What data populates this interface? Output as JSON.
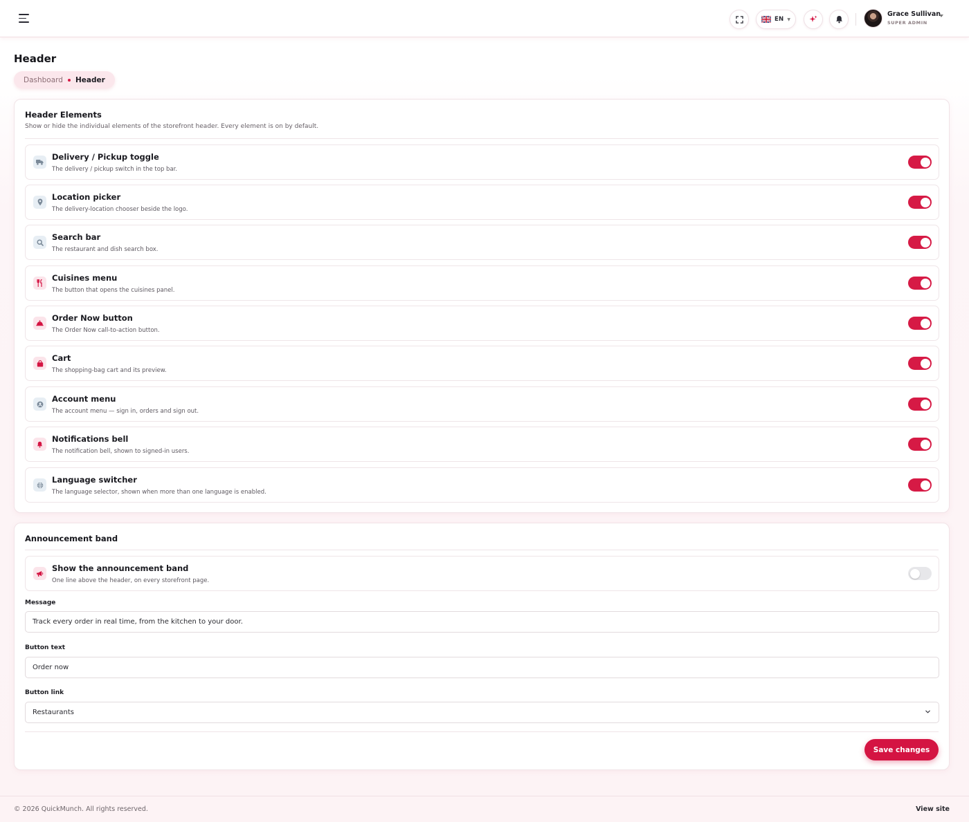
{
  "topbar": {
    "language_code": "EN",
    "user_name": "Grace Sullivan",
    "user_role": "SUPER ADMIN",
    "icons": [
      "menu-icon",
      "fullscreen-icon",
      "uk-flag-icon",
      "sparkle-icon",
      "bell-icon",
      "chevron-down-icon"
    ]
  },
  "page": {
    "title": "Header",
    "breadcrumb": {
      "parent": "Dashboard",
      "current": "Header"
    }
  },
  "header_elements": {
    "title": "Header Elements",
    "subtitle": "Show or hide the individual elements of the storefront header. Every element is on by default.",
    "items": [
      {
        "title": "Delivery / Pickup toggle",
        "desc": "The delivery / pickup switch in the top bar.",
        "enabled": true,
        "icon": "truck-icon"
      },
      {
        "title": "Location picker",
        "desc": "The delivery-location chooser beside the logo.",
        "enabled": true,
        "icon": "map-pin-icon"
      },
      {
        "title": "Search bar",
        "desc": "The restaurant and dish search box.",
        "enabled": true,
        "icon": "search-icon"
      },
      {
        "title": "Cuisines menu",
        "desc": "The button that opens the cuisines panel.",
        "enabled": true,
        "icon": "utensils-icon"
      },
      {
        "title": "Order Now button",
        "desc": "The Order Now call-to-action button.",
        "enabled": true,
        "icon": "cloche-icon"
      },
      {
        "title": "Cart",
        "desc": "The shopping-bag cart and its preview.",
        "enabled": true,
        "icon": "shopping-bag-icon"
      },
      {
        "title": "Account menu",
        "desc": "The account menu — sign in, orders and sign out.",
        "enabled": true,
        "icon": "user-circle-icon"
      },
      {
        "title": "Notifications bell",
        "desc": "The notification bell, shown to signed-in users.",
        "enabled": true,
        "icon": "bell-icon"
      },
      {
        "title": "Language switcher",
        "desc": "The language selector, shown when more than one language is enabled.",
        "enabled": true,
        "icon": "globe-icon"
      }
    ]
  },
  "announcement": {
    "title": "Announcement band",
    "toggle_title": "Show the announcement band",
    "toggle_desc": "One line above the header, on every storefront page.",
    "enabled": false,
    "icon": "megaphone-icon",
    "message_label": "Message",
    "message_value": "Track every order in real time, from the kitchen to your door.",
    "button_text_label": "Button text",
    "button_text_value": "Order now",
    "button_link_label": "Button link",
    "button_link_value": "Restaurants",
    "save_label": "Save changes"
  },
  "footer": {
    "copyright": "© 2026 QuickMunch. All rights reserved.",
    "view_site": "View site"
  },
  "colors": {
    "accent": "#d41442",
    "toggle_on": "#d61a45",
    "toggle_off": "#e7e7ea",
    "page_bg": "#fdf3f5"
  }
}
